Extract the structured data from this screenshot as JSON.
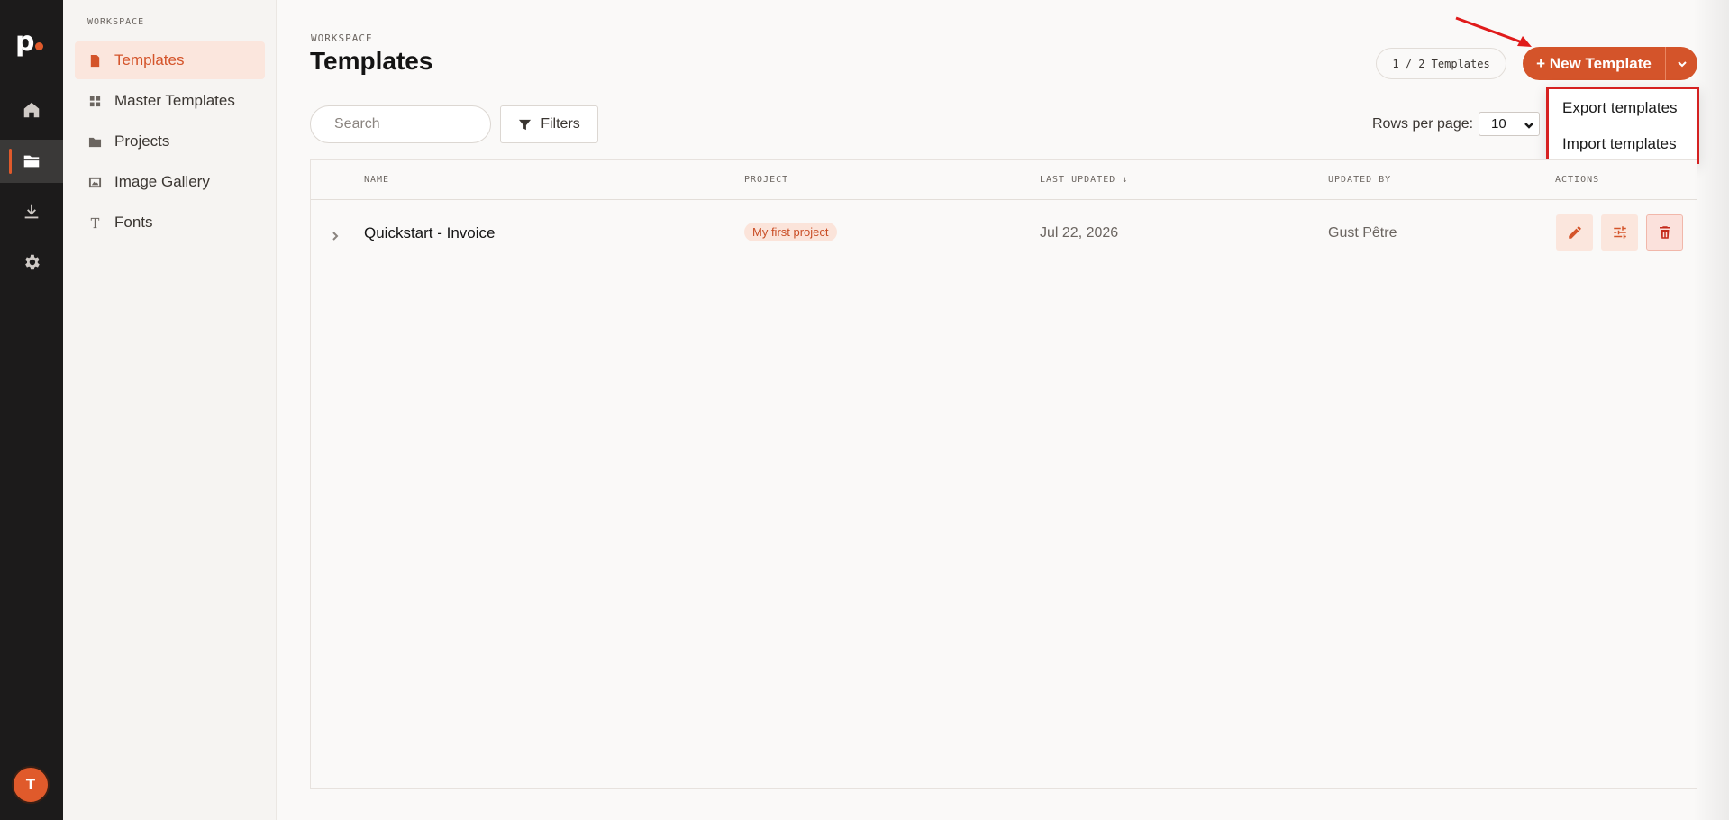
{
  "rail": {
    "logo_text": "p",
    "items": [
      "home",
      "templates",
      "downloads",
      "settings"
    ],
    "avatar_initial": "T"
  },
  "sidebar": {
    "section_label": "WORKSPACE",
    "items": [
      {
        "label": "Templates",
        "icon": "document-icon",
        "active": true
      },
      {
        "label": "Master Templates",
        "icon": "master-templates-icon",
        "active": false
      },
      {
        "label": "Projects",
        "icon": "folder-icon",
        "active": false
      },
      {
        "label": "Image Gallery",
        "icon": "image-icon",
        "active": false
      },
      {
        "label": "Fonts",
        "icon": "font-icon",
        "active": false
      }
    ]
  },
  "header": {
    "breadcrumb": "WORKSPACE",
    "title": "Templates",
    "count": "1 / 2 Templates",
    "new_button": "+ New Template"
  },
  "dropdown": {
    "items": [
      "Export templates",
      "Import templates"
    ]
  },
  "toolbar": {
    "search_placeholder": "Search",
    "filters_label": "Filters",
    "rows_per_page_label": "Rows per page:",
    "rows_per_page_value": "10"
  },
  "table": {
    "columns": [
      "NAME",
      "PROJECT",
      "LAST UPDATED ↓",
      "UPDATED BY",
      "ACTIONS"
    ],
    "rows": [
      {
        "name": "Quickstart - Invoice",
        "project": "My first project",
        "last_updated": "Jul 22, 2026",
        "updated_by": "Gust Pêtre"
      }
    ]
  },
  "colors": {
    "accent": "#d4542a",
    "rail_bg": "#1c1b1b",
    "highlight_border": "#d62121"
  }
}
